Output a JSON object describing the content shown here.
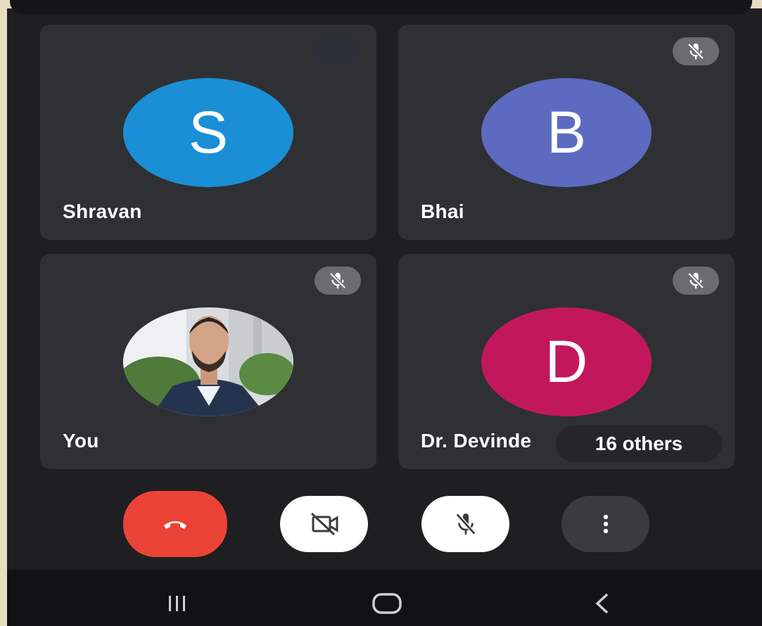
{
  "participants": [
    {
      "name": "Shravan",
      "initial": "S",
      "color": "#1a8fd6",
      "muted": false
    },
    {
      "name": "Bhai",
      "initial": "B",
      "color": "#5c6bc0",
      "muted": true
    },
    {
      "name": "You",
      "initial": "",
      "color": "",
      "muted": true,
      "has_photo": true
    },
    {
      "name": "Dr. Devinde",
      "initial": "D",
      "color": "#c2185b",
      "muted": true
    }
  ],
  "others_label": "16 others",
  "controls": {
    "end_call_icon": "phone-hangup-icon",
    "camera_icon": "camera-off-icon",
    "mic_icon": "mic-off-icon",
    "more_icon": "more-vertical-icon"
  },
  "navigation": {
    "recents_icon": "recents-icon",
    "home_icon": "home-icon",
    "back_icon": "back-icon"
  },
  "colors": {
    "background": "#1f1f21",
    "tile": "#2f3034",
    "end_call": "#ea4335"
  }
}
